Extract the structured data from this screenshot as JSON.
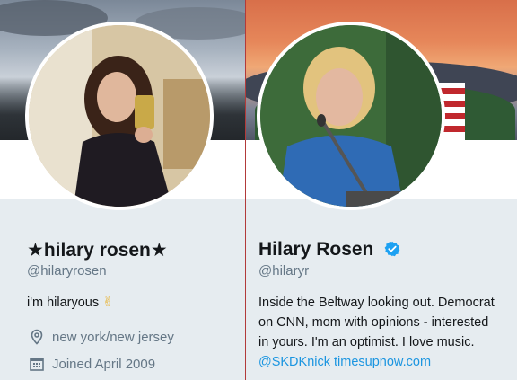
{
  "left_profile": {
    "display_name": "★hilary rosen★",
    "handle": "@hilaryrosen",
    "bio": "i'm hilaryous",
    "bio_emoji": "✌",
    "location": "new york/new jersey",
    "joined": "Joined April 2009",
    "location_icon": "map-pin-icon",
    "joined_icon": "calendar-icon"
  },
  "right_profile": {
    "display_name": "Hilary Rosen",
    "handle": "@hilaryr",
    "verified_icon": "verified-badge-icon",
    "bio_lines": [
      "Inside the Beltway looking out. Democrat",
      "on CNN, mom with opinions - interested",
      "in yours. I'm an optimist. I love music."
    ],
    "bio_mention": "@SKDKnick",
    "bio_link": "timesupnow.com"
  },
  "colors": {
    "link": "#1b95e0",
    "secondary_text": "#657786",
    "primary_text": "#14171a",
    "background": "#e6ecf0"
  }
}
